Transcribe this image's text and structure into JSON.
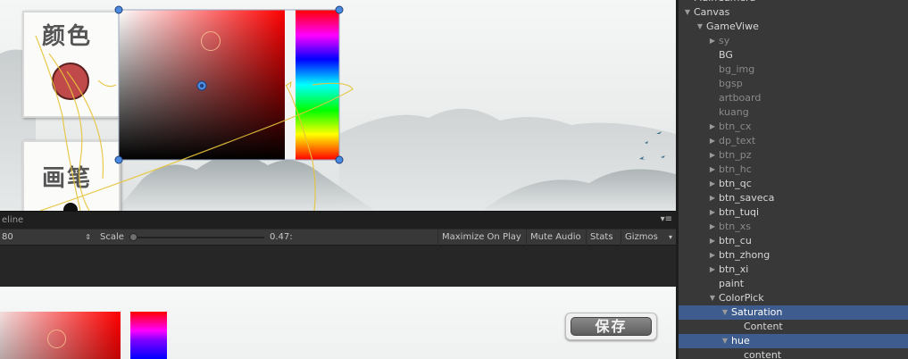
{
  "scene": {
    "color_label": "颜色",
    "brush_label": "画笔"
  },
  "game_toolbar": {
    "tab_label": "eline",
    "resolution": "80",
    "scale_label": "Scale",
    "scale_value": "0.47:",
    "maximize_on_play": "Maximize On Play",
    "mute_audio": "Mute Audio",
    "stats": "Stats",
    "gizmos": "Gizmos"
  },
  "game": {
    "save_button": "保存"
  },
  "colors": {
    "saturation_base": "#ff0000",
    "brush_swatch": "#c0494a",
    "selection": "#3e5d8e",
    "panel_bg": "#383838"
  },
  "hierarchy": {
    "items": [
      {
        "label": "MainCamera",
        "expandable": false,
        "expanded": false,
        "active": true,
        "selected": false,
        "depth": 1
      },
      {
        "label": "Canvas",
        "expandable": true,
        "expanded": true,
        "active": true,
        "selected": false,
        "depth": 1
      },
      {
        "label": "GameViwe",
        "expandable": true,
        "expanded": true,
        "active": true,
        "selected": false,
        "depth": 2
      },
      {
        "label": "sy",
        "expandable": true,
        "expanded": false,
        "active": false,
        "selected": false,
        "depth": 3
      },
      {
        "label": "BG",
        "expandable": false,
        "expanded": false,
        "active": true,
        "selected": false,
        "depth": 3
      },
      {
        "label": "bg_img",
        "expandable": false,
        "expanded": false,
        "active": false,
        "selected": false,
        "depth": 3
      },
      {
        "label": "bgsp",
        "expandable": false,
        "expanded": false,
        "active": false,
        "selected": false,
        "depth": 3
      },
      {
        "label": "artboard",
        "expandable": false,
        "expanded": false,
        "active": false,
        "selected": false,
        "depth": 3
      },
      {
        "label": "kuang",
        "expandable": false,
        "expanded": false,
        "active": false,
        "selected": false,
        "depth": 3
      },
      {
        "label": "btn_cx",
        "expandable": true,
        "expanded": false,
        "active": false,
        "selected": false,
        "depth": 3
      },
      {
        "label": "dp_text",
        "expandable": true,
        "expanded": false,
        "active": false,
        "selected": false,
        "depth": 3
      },
      {
        "label": "btn_pz",
        "expandable": true,
        "expanded": false,
        "active": false,
        "selected": false,
        "depth": 3
      },
      {
        "label": "btn_hc",
        "expandable": true,
        "expanded": false,
        "active": false,
        "selected": false,
        "depth": 3
      },
      {
        "label": "btn_qc",
        "expandable": true,
        "expanded": false,
        "active": true,
        "selected": false,
        "depth": 3
      },
      {
        "label": "btn_saveca",
        "expandable": true,
        "expanded": false,
        "active": true,
        "selected": false,
        "depth": 3
      },
      {
        "label": "btn_tuqi",
        "expandable": true,
        "expanded": false,
        "active": true,
        "selected": false,
        "depth": 3
      },
      {
        "label": "btn_xs",
        "expandable": true,
        "expanded": false,
        "active": false,
        "selected": false,
        "depth": 3
      },
      {
        "label": "btn_cu",
        "expandable": true,
        "expanded": false,
        "active": true,
        "selected": false,
        "depth": 3
      },
      {
        "label": "btn_zhong",
        "expandable": true,
        "expanded": false,
        "active": true,
        "selected": false,
        "depth": 3
      },
      {
        "label": "btn_xi",
        "expandable": true,
        "expanded": false,
        "active": true,
        "selected": false,
        "depth": 3
      },
      {
        "label": "paint",
        "expandable": false,
        "expanded": false,
        "active": true,
        "selected": false,
        "depth": 3
      },
      {
        "label": "ColorPick",
        "expandable": true,
        "expanded": true,
        "active": true,
        "selected": false,
        "depth": 3
      },
      {
        "label": "Saturation",
        "expandable": true,
        "expanded": true,
        "active": true,
        "selected": true,
        "depth": 4
      },
      {
        "label": "Content",
        "expandable": false,
        "expanded": false,
        "active": true,
        "selected": false,
        "depth": 5
      },
      {
        "label": "hue",
        "expandable": true,
        "expanded": true,
        "active": true,
        "selected": true,
        "depth": 4
      },
      {
        "label": "content",
        "expandable": false,
        "expanded": false,
        "active": true,
        "selected": false,
        "depth": 5
      }
    ]
  }
}
